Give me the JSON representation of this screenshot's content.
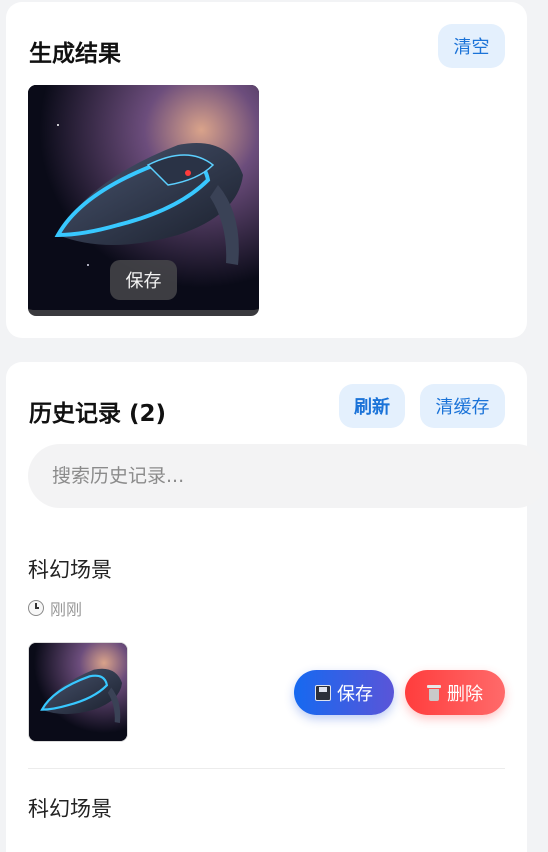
{
  "result": {
    "title": "生成结果",
    "clear_label": "清空",
    "save_label": "保存"
  },
  "history": {
    "title": "历史记录 (2)",
    "refresh_label": "刷新",
    "clear_cache_label": "清缓存",
    "search": {
      "placeholder": "搜索历史记录...",
      "value": ""
    },
    "items": [
      {
        "title": "科幻场景",
        "time": "刚刚",
        "save_label": "保存",
        "delete_label": "删除"
      },
      {
        "title": "科幻场景"
      }
    ]
  },
  "colors": {
    "accent": "#1b73d8",
    "save": "#1669f0",
    "delete": "#ff4a4a"
  }
}
